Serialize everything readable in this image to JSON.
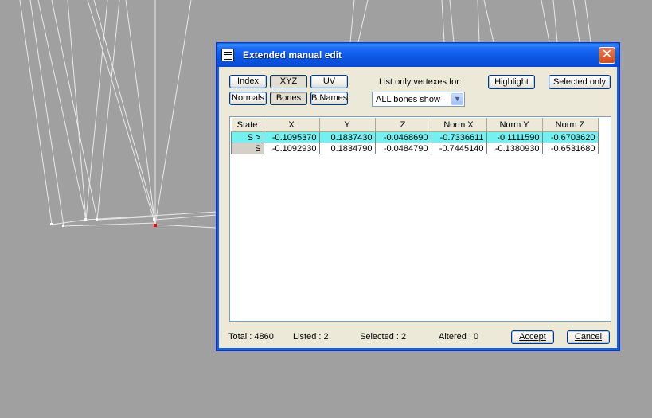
{
  "window": {
    "title": "Extended manual edit",
    "close_glyph": "✕"
  },
  "toolbar": {
    "index": "Index",
    "xyz": "XYZ",
    "uv": "UV",
    "normals": "Normals",
    "bones": "Bones",
    "bnames": "B.Names",
    "list_label": "List only vertexes for:",
    "filter_value": "ALL bones show",
    "highlight": "Highlight",
    "selected_only": "Selected only"
  },
  "grid": {
    "columns": [
      "State",
      "X",
      "Y",
      "Z",
      "Norm X",
      "Norm Y",
      "Norm Z"
    ],
    "rows": [
      [
        "S >",
        "-0.1095370",
        "0.1837430",
        "-0.0468690",
        "-0.7336611",
        "-0.1111590",
        "-0.6703620"
      ],
      [
        "S",
        "-0.1092930",
        "0.1834790",
        "-0.0484790",
        "-0.7445140",
        "-0.1380930",
        "-0.6531680"
      ]
    ]
  },
  "status": {
    "total": "Total : 4860",
    "listed": "Listed : 2",
    "selected": "Selected : 2",
    "altered": "Altered : 0"
  },
  "actions": {
    "accept": "Accept",
    "cancel": "Cancel"
  },
  "colors": {
    "title_bar": "#0a57e4",
    "selected_row": "#74f0f0",
    "viewport_bg": "#a0a0a0"
  },
  "icons": {
    "window_icon": "grid-table-icon",
    "close": "close-icon",
    "dropdown": "chevron-down-icon"
  }
}
